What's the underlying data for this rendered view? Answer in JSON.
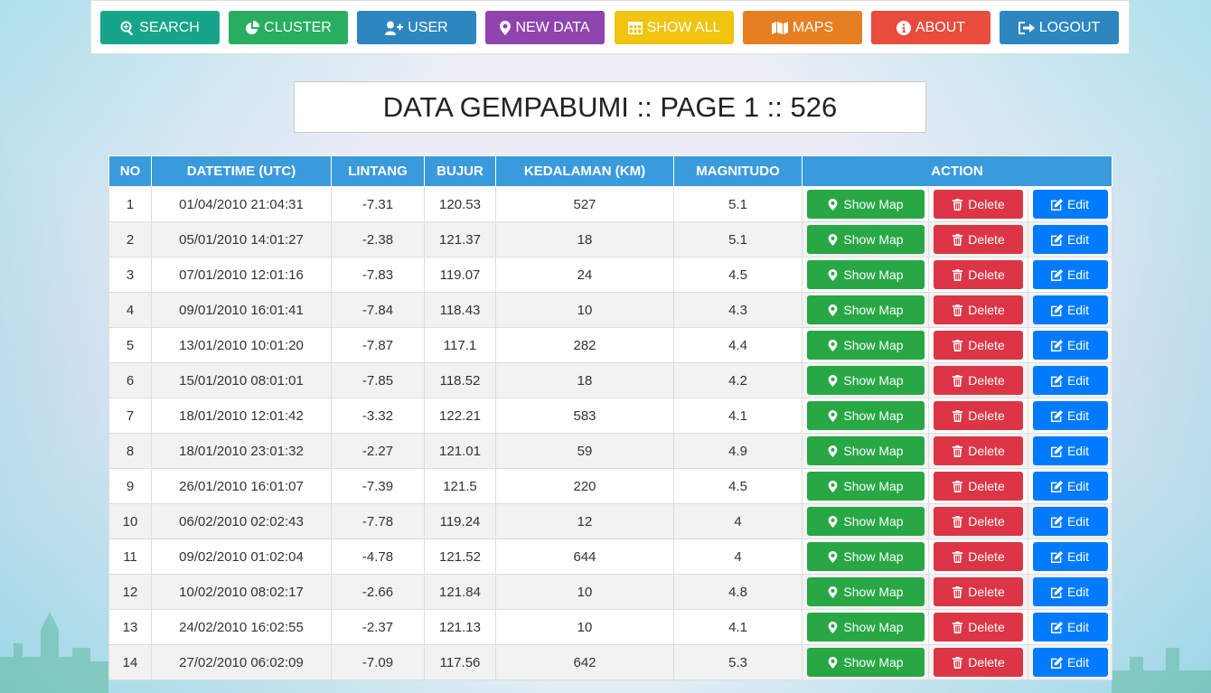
{
  "colors": {
    "search": "#17a589",
    "cluster": "#27ae60",
    "user": "#2e86c1",
    "new_data": "#8e44ad",
    "show_all": "#f1c40f",
    "maps": "#e67e22",
    "about": "#e74c3c",
    "logout": "#2e86c1",
    "header": "#3a9bdc",
    "show_map": "#28a745",
    "delete": "#dc3545",
    "edit": "#007bff"
  },
  "nav": {
    "search": {
      "label": "SEARCH",
      "icon": "search-plus-icon"
    },
    "cluster": {
      "label": "CLUSTER",
      "icon": "pie-chart-icon"
    },
    "user": {
      "label": "USER",
      "icon": "user-plus-icon"
    },
    "new_data": {
      "label": "NEW DATA",
      "icon": "map-marker-icon"
    },
    "show_all": {
      "label": "SHOW ALL",
      "icon": "table-icon"
    },
    "maps": {
      "label": "MAPS",
      "icon": "map-icon"
    },
    "about": {
      "label": "ABOUT",
      "icon": "info-circle-icon"
    },
    "logout": {
      "label": "LOGOUT",
      "icon": "sign-out-icon"
    }
  },
  "page_title": "DATA GEMPABUMI :: PAGE 1 :: 526",
  "table": {
    "headers": [
      "NO",
      "DATETIME (UTC)",
      "LINTANG",
      "BUJUR",
      "KEDALAMAN (KM)",
      "MAGNITUDO",
      "ACTION"
    ],
    "actions": {
      "show_map": "Show Map",
      "delete": "Delete",
      "edit": "Edit"
    },
    "rows": [
      [
        "1",
        "01/04/2010 21:04:31",
        "-7.31",
        "120.53",
        "527",
        "5.1"
      ],
      [
        "2",
        "05/01/2010 14:01:27",
        "-2.38",
        "121.37",
        "18",
        "5.1"
      ],
      [
        "3",
        "07/01/2010 12:01:16",
        "-7.83",
        "119.07",
        "24",
        "4.5"
      ],
      [
        "4",
        "09/01/2010 16:01:41",
        "-7.84",
        "118.43",
        "10",
        "4.3"
      ],
      [
        "5",
        "13/01/2010 10:01:20",
        "-7.87",
        "117.1",
        "282",
        "4.4"
      ],
      [
        "6",
        "15/01/2010 08:01:01",
        "-7.85",
        "118.52",
        "18",
        "4.2"
      ],
      [
        "7",
        "18/01/2010 12:01:42",
        "-3.32",
        "122.21",
        "583",
        "4.1"
      ],
      [
        "8",
        "18/01/2010 23:01:32",
        "-2.27",
        "121.01",
        "59",
        "4.9"
      ],
      [
        "9",
        "26/01/2010 16:01:07",
        "-7.39",
        "121.5",
        "220",
        "4.5"
      ],
      [
        "10",
        "06/02/2010 02:02:43",
        "-7.78",
        "119.24",
        "12",
        "4"
      ],
      [
        "11",
        "09/02/2010 01:02:04",
        "-4.78",
        "121.52",
        "644",
        "4"
      ],
      [
        "12",
        "10/02/2010 08:02:17",
        "-2.66",
        "121.84",
        "10",
        "4.8"
      ],
      [
        "13",
        "24/02/2010 16:02:55",
        "-2.37",
        "121.13",
        "10",
        "4.1"
      ],
      [
        "14",
        "27/02/2010 06:02:09",
        "-7.09",
        "117.56",
        "642",
        "5.3"
      ]
    ]
  }
}
